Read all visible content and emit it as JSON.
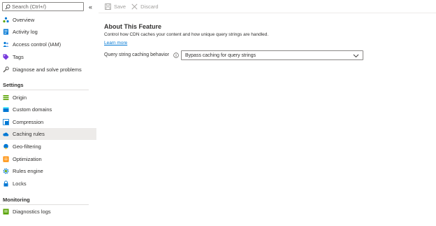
{
  "sidebar": {
    "search_placeholder": "Search (Ctrl+/)",
    "collapse_glyph": "«",
    "top_items": [
      {
        "label": "Overview",
        "icon": "cloud-overview-icon"
      },
      {
        "label": "Activity log",
        "icon": "activity-log-icon"
      },
      {
        "label": "Access control (IAM)",
        "icon": "iam-people-icon"
      },
      {
        "label": "Tags",
        "icon": "tag-icon"
      },
      {
        "label": "Diagnose and solve problems",
        "icon": "wrench-icon"
      }
    ],
    "settings_header": "Settings",
    "settings_items": [
      {
        "label": "Origin",
        "icon": "origin-icon"
      },
      {
        "label": "Custom domains",
        "icon": "custom-domains-icon"
      },
      {
        "label": "Compression",
        "icon": "compression-icon"
      },
      {
        "label": "Caching rules",
        "icon": "caching-cloud-icon",
        "selected": true
      },
      {
        "label": "Geo-filtering",
        "icon": "globe-pin-icon"
      },
      {
        "label": "Optimization",
        "icon": "optimization-icon"
      },
      {
        "label": "Rules engine",
        "icon": "gear-icon"
      },
      {
        "label": "Locks",
        "icon": "lock-icon"
      }
    ],
    "monitoring_header": "Monitoring",
    "monitoring_items": [
      {
        "label": "Diagnostics logs",
        "icon": "diagnostics-log-icon"
      }
    ]
  },
  "toolbar": {
    "save_label": "Save",
    "discard_label": "Discard"
  },
  "main": {
    "title": "About This Feature",
    "description": "Control how CDN caches your content and how unique query strings are handled.",
    "learn_more": "Learn more",
    "field_label": "Query string caching behavior",
    "dropdown_value": "Bypass caching for query strings"
  },
  "colors": {
    "accent": "#0078d4",
    "selected_bg": "#edebe9",
    "disabled_text": "#a19f9d"
  }
}
